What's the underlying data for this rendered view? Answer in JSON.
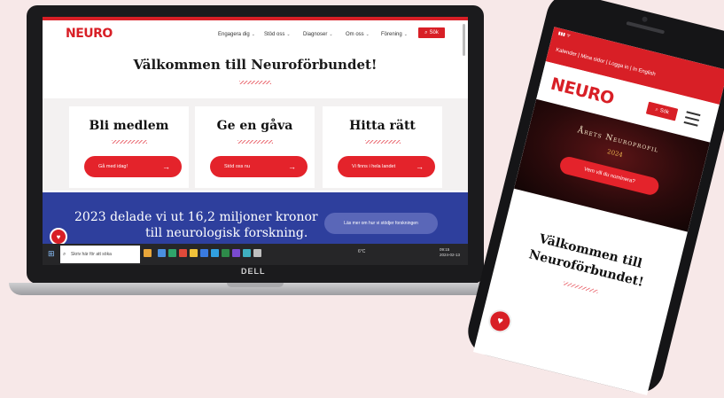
{
  "colors": {
    "brand_red": "#d81f26",
    "banner_blue": "#2e3f9d",
    "page_bg": "#f7e8e8"
  },
  "laptop": {
    "brand": "DELL",
    "site": {
      "logo": "NEURO",
      "nav": [
        "Engagera dig",
        "Stöd oss",
        "Diagnoser",
        "Om oss",
        "Förening"
      ],
      "search_label": "Sök",
      "welcome_title": "Välkommen till Neuroförbundet!",
      "cards": [
        {
          "title": "Bli medlem",
          "button": "Gå med idag!"
        },
        {
          "title": "Ge en gåva",
          "button": "Stöd oss nu"
        },
        {
          "title": "Hitta rätt",
          "button": "Vi finns i hela landet"
        }
      ],
      "banner": {
        "line1": "2023 delade vi ut 16,2 miljoner kronor",
        "line2": "till neurologisk forskning.",
        "button": "Läs mer om hur vi stödjer forskningen"
      }
    },
    "taskbar": {
      "search_placeholder": "Skriv här för att söka",
      "clock_time": "09:15",
      "clock_date": "2024-02-13",
      "weather": "6°C"
    }
  },
  "phone": {
    "top_links": "Kalender | Mina sidor | Logga in | In English",
    "logo": "NEURO",
    "search_label": "Sök",
    "profile_title": "Årets Neuroprofil",
    "profile_year": "2024",
    "nominate_button": "Vem vill du nominera?",
    "welcome_line1": "Välkommen till",
    "welcome_line2": "Neuroförbundet!"
  }
}
